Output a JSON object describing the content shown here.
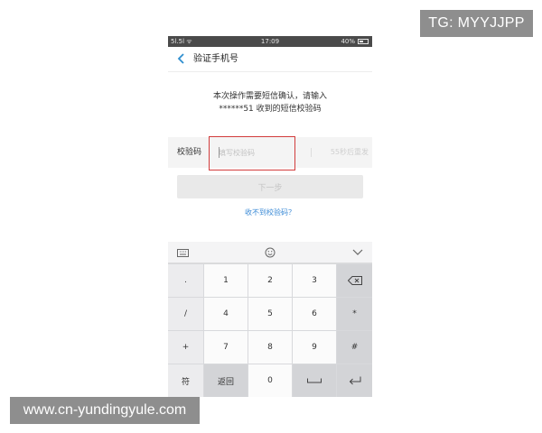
{
  "watermarks": {
    "tg": "TG: MYYJJPP",
    "site": "www.cn-yundingyule.com"
  },
  "status_bar": {
    "left": "5l.5l ᯤ",
    "time": "17:09",
    "battery_percent": "40%"
  },
  "header": {
    "back_icon": "chevron-left-icon",
    "title": "验证手机号"
  },
  "prompt": {
    "line1": "本次操作需要短信确认，请输入",
    "line2": "******51 收到的短信校验码"
  },
  "code_field": {
    "label": "校验码",
    "placeholder": "填写校验码",
    "value": "",
    "resend": "55秒后重发"
  },
  "next_button": {
    "label": "下一步"
  },
  "no_code_link": "收不到校验码？",
  "colors": {
    "accent": "#3a8ad6",
    "highlight": "#d23c3c",
    "status_bar": "#4a4a4a"
  },
  "keyboard": {
    "toolbar": {
      "left_icon": "keyboard-icon",
      "center_icon": "emoji-icon",
      "right_icon": "chevron-down-icon"
    },
    "symbols": [
      ".",
      "/",
      "+",
      "-"
    ],
    "rows": [
      [
        "1",
        "2",
        "3"
      ],
      [
        "4",
        "5",
        "6"
      ],
      [
        "7",
        "8",
        "9"
      ]
    ],
    "right_column": [
      "*",
      "#"
    ],
    "bottom": {
      "symbols_key": "符",
      "back_key": "返回",
      "zero": "0"
    },
    "icons": {
      "delete": "backspace-icon",
      "space": "space-icon",
      "enter": "enter-icon"
    }
  }
}
